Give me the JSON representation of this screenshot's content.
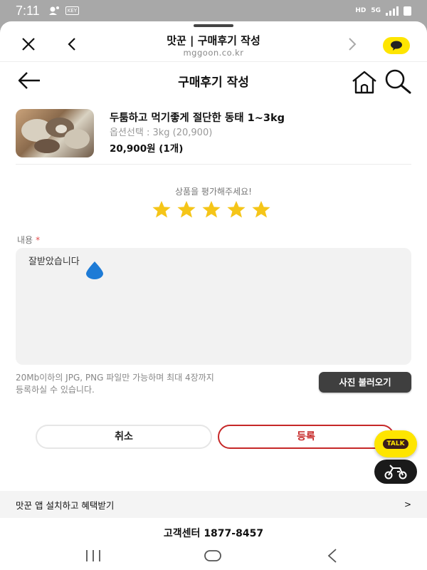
{
  "status_bar": {
    "time": "7:11",
    "key_badge": "KEY",
    "network_hd": "HD",
    "network_5g": "5G"
  },
  "webview": {
    "title": "맛꾼 | 구매후기 작성",
    "url": "mggoon.co.kr"
  },
  "header": {
    "title": "구매후기 작성"
  },
  "product": {
    "name": "두툼하고 먹기좋게 절단한 동태 1~3kg",
    "option": "옵션선택 : 3kg (20,900)",
    "price": "20,900원 (1개)"
  },
  "rating": {
    "prompt": "상품을 평가해주세요!",
    "value": 5,
    "max": 5,
    "star_color": "#f5c518"
  },
  "review": {
    "label": "내용",
    "required_mark": "*",
    "text": "잘받았습니다"
  },
  "upload": {
    "note_line1": "20Mb이하의 JPG, PNG 파일만 가능하며 최대 4장까지",
    "note_line2": "등록하실 수 있습니다.",
    "photo_button": "사진 불러오기"
  },
  "actions": {
    "cancel": "취소",
    "submit": "등록"
  },
  "floating": {
    "talk": "TALK"
  },
  "footer": {
    "app_banner": "맛꾼 앱 설치하고 혜택받기",
    "banner_chevron": ">",
    "customer_center": "고객센터 1877-8457"
  },
  "colors": {
    "accent_red": "#c62828",
    "kakao_yellow": "#fee500"
  }
}
